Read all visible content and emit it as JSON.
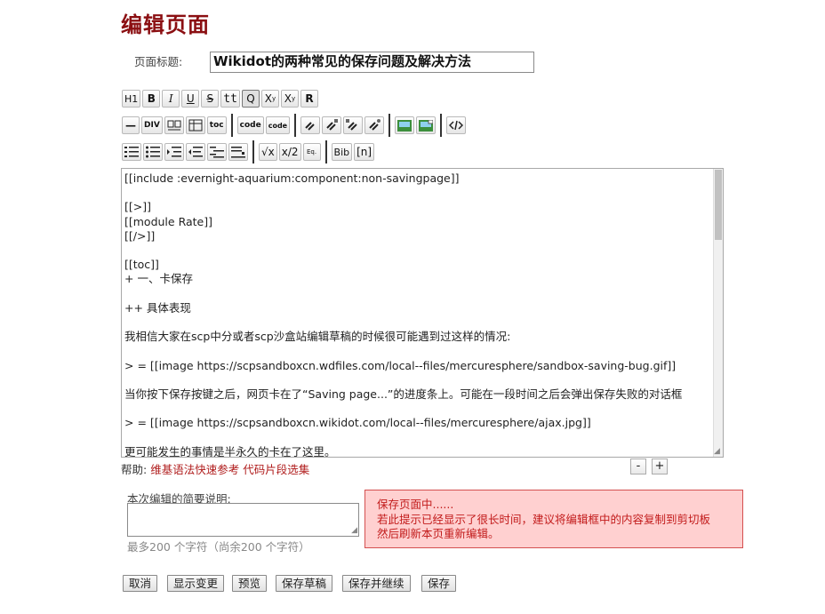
{
  "page": {
    "heading": "编辑页面",
    "title_label": "页面标题:",
    "title_value": "Wikidot的两种常见的保存问题及解决方法"
  },
  "toolbar": {
    "row1": [
      "H1",
      "B",
      "I",
      "U",
      "S",
      "tt",
      "Q",
      "X",
      "X",
      "R"
    ],
    "row2": [
      "—",
      "DIV",
      "toc",
      "code",
      "code"
    ],
    "row3": [
      "√x",
      "x/2",
      "Eq.",
      "Bib",
      "[n]"
    ]
  },
  "editor": {
    "content": "[[include :evernight-aquarium:component:non-savingpage]]\n\n[[>]]\n[[module Rate]]\n[[/>]]\n\n[[toc]]\n+ 一、卡保存\n\n++ 具体表现\n\n我相信大家在scp中分或者scp沙盒站编辑草稿的时候很可能遇到过这样的情况:\n\n> = [[image https://scpsandboxcn.wdfiles.com/local--files/mercuresphere/sandbox-saving-bug.gif]]\n\n当你按下保存按键之后，网页卡在了“Saving page...”的进度条上。可能在一段时间之后会弹出保存失败的对话框\n\n> = [[image https://scpsandboxcn.wikidot.com/local--files/mercuresphere/ajax.jpg]]\n\n更可能发生的事情是半永久的卡在了这里。"
  },
  "help": {
    "label": "帮助:",
    "link1": "维基语法快速参考",
    "link2": "代码片段选集",
    "shrink": "-",
    "grow": "+"
  },
  "summary": {
    "label": "本次编辑的简要说明:",
    "limit": "最多200 个字符（尚余200 个字符）"
  },
  "alert": {
    "line1": "保存页面中......",
    "line2": "若此提示已经显示了很长时间，建议将编辑框中的内容复制到剪切板",
    "line3": "然后刷新本页重新编辑。"
  },
  "actions": {
    "cancel": "取消",
    "diff": "显示变更",
    "preview": "预览",
    "save_draft": "保存草稿",
    "save_continue": "保存并继续",
    "save": "保存"
  },
  "colors": {
    "heading": "#8b0f12",
    "link": "#b01c1c",
    "alert_bg": "#ffd0d0",
    "alert_text": "#c21b1b"
  }
}
